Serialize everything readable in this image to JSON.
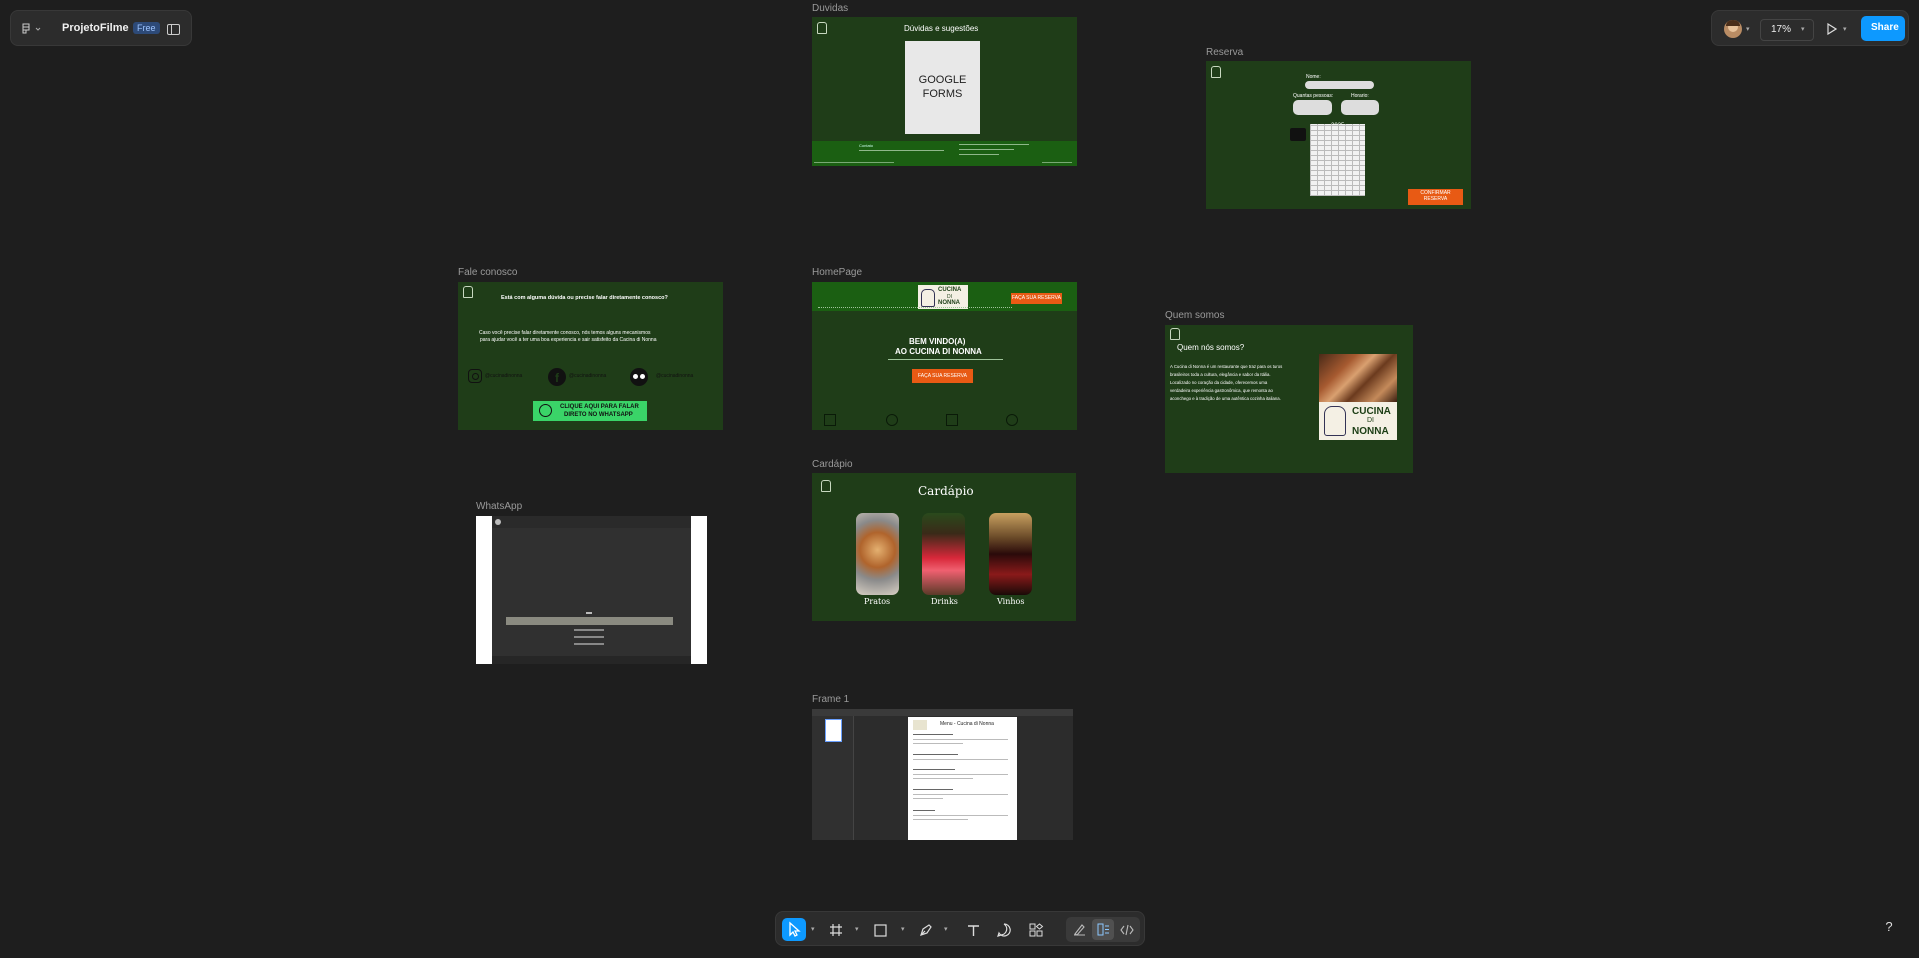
{
  "header": {
    "project_name": "ProjetoFilme",
    "plan_badge": "Free",
    "zoom": "17%",
    "share_label": "Share"
  },
  "frames": {
    "duvidas": {
      "label": "Duvidas",
      "title": "Dúvidas e sugestões",
      "form_text": "GOOGLE FORMS",
      "footer_left": "Contato"
    },
    "reserva": {
      "label": "Reserva",
      "name_label": "Nome:",
      "people_label": "Quantas pessoas:",
      "time_label": "Horario:",
      "year": "2025",
      "confirm_btn": "CONFIRMAR RESERVA"
    },
    "fale": {
      "label": "Fale conosco",
      "question": "Está com alguma dúvida ou precise falar diretamente conosco?",
      "text_line1": "Caso você precise falar diretamente conosco, nós temos alguns mecanismos",
      "text_line2": "para ajudar você a ter uma boa experiencia e sair satisfeito da Cacina di Nonna",
      "social_handle": "@cucinadinonna",
      "whatsapp_line1": "CLIQUE AQUI PARA FALAR",
      "whatsapp_line2": "DIRETO NO WHATSAPP"
    },
    "home": {
      "label": "HomePage",
      "logo_line1": "CUCINA",
      "logo_line2": "DI",
      "logo_line3": "NONNA",
      "reserve_btn": "FAÇA SUA RESERVA",
      "welcome_line1": "BEM VINDO(A)",
      "welcome_line2": "AO CUCINA DI NONNA",
      "cta_btn": "FAÇA SUA RESERVA"
    },
    "quem": {
      "label": "Quem somos",
      "title": "Quem nós somos?",
      "text": [
        "A Cucina di Nonna é um restaurante que traz para os turos",
        "brasileiros toda a cultura, elegância e sabor da Itália.",
        "Localizado no coração da cidade, oferecemos uma",
        "verdadeira experiência gastronômica, que remonta ao",
        "aconchego e à tradição de uma autêntica cozinha italiana."
      ],
      "logo_line1": "CUCINA",
      "logo_line2": "DI",
      "logo_line3": "NONNA"
    },
    "cardapio": {
      "label": "Cardápio",
      "title": "Cardápio",
      "items": [
        "Pratos",
        "Drinks",
        "Vinhos"
      ]
    },
    "whatsapp": {
      "label": "WhatsApp"
    },
    "frame1": {
      "label": "Frame 1",
      "doc_title": "Menu - Cucina di Nonna"
    }
  },
  "toolbar": {
    "tools": [
      "move-tool",
      "frame-tool",
      "shape-tool",
      "pen-tool",
      "text-tool",
      "comment-tool",
      "actions-tool"
    ],
    "modes": [
      "draw-mode",
      "design-mode",
      "dev-mode"
    ]
  },
  "help_label": "?",
  "colors": {
    "canvas": "#1e1e1e",
    "frame_green": "#1f3d18",
    "accent_orange": "#e85a14",
    "share_blue": "#0d99ff",
    "whatsapp_green": "#3ad468"
  }
}
